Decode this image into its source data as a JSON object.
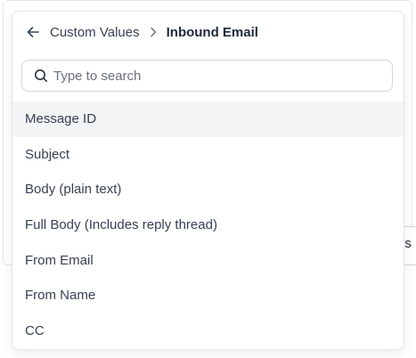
{
  "header": {
    "back_icon": "arrow-left-icon",
    "breadcrumb_parent": "Custom Values",
    "separator_icon": "chevron-right-icon",
    "breadcrumb_current": "Inbound Email"
  },
  "search": {
    "icon": "search-icon",
    "placeholder": "Type to search",
    "value": ""
  },
  "options": [
    {
      "label": "Message ID",
      "highlighted": true
    },
    {
      "label": "Subject"
    },
    {
      "label": "Body (plain text)"
    },
    {
      "label": "Full Body (Includes reply thread)"
    },
    {
      "label": "From Email"
    },
    {
      "label": "From Name"
    },
    {
      "label": "CC"
    }
  ],
  "background": {
    "partial_text": "ers"
  },
  "colors": {
    "highlight": "#f3f4f6",
    "border": "#e5e7eb",
    "text": "#374151"
  }
}
